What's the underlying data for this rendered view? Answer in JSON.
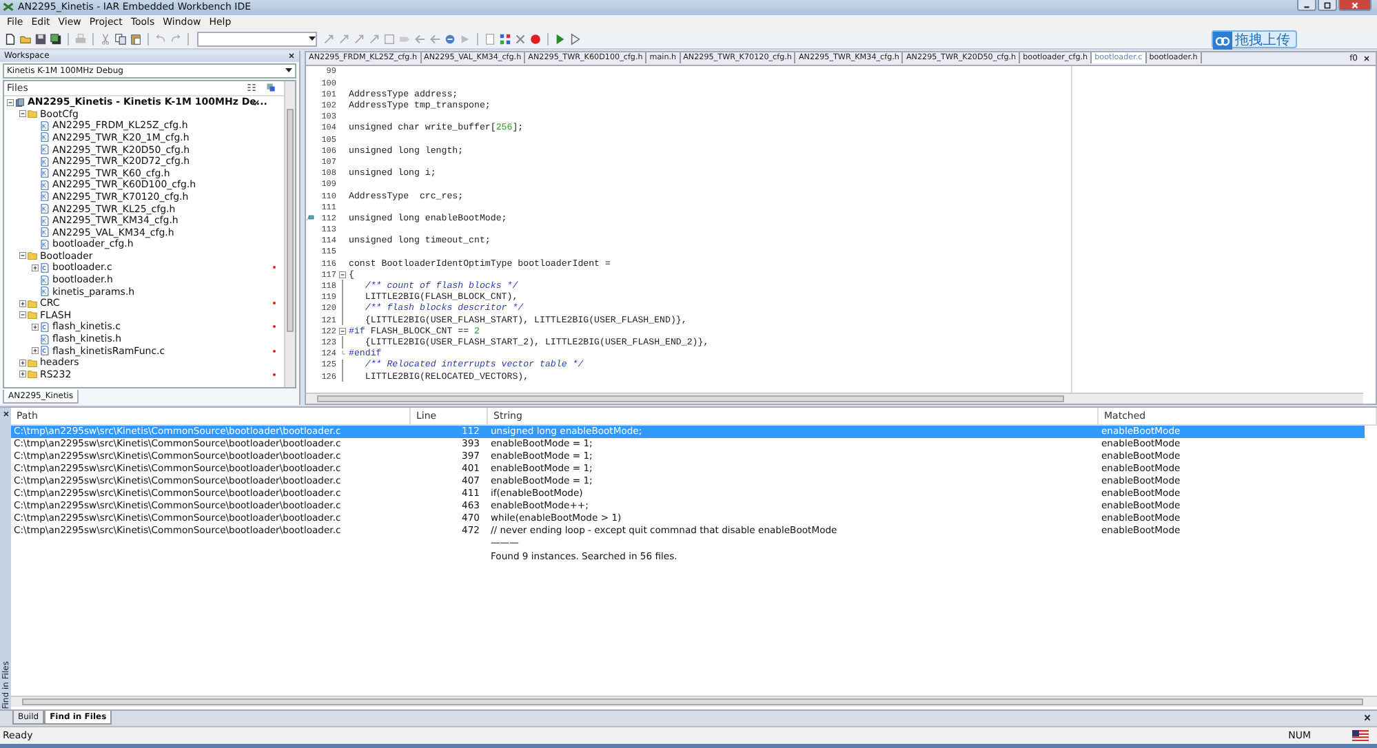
{
  "window": {
    "title": "AN2295_Kinetis - IAR Embedded Workbench IDE"
  },
  "menu": [
    "File",
    "Edit",
    "View",
    "Project",
    "Tools",
    "Window",
    "Help"
  ],
  "upload_button": "拖拽上传",
  "workspace": {
    "title": "Workspace",
    "configuration": "Kinetis K-1M 100MHz Debug",
    "files_header": "Files",
    "tree": [
      {
        "label": "AN2295_Kinetis - Kinetis K-1M 100MHz De...",
        "kind": "project",
        "expanded": true,
        "checked": true,
        "marked": false,
        "children": [
          {
            "label": "BootCfg",
            "kind": "folder",
            "expanded": true,
            "marked": false,
            "children": [
              {
                "label": "AN2295_FRDM_KL25Z_cfg.h",
                "kind": "header",
                "marked": false
              },
              {
                "label": "AN2295_TWR_K20_1M_cfg.h",
                "kind": "header",
                "marked": false
              },
              {
                "label": "AN2295_TWR_K20D50_cfg.h",
                "kind": "header",
                "marked": false
              },
              {
                "label": "AN2295_TWR_K20D72_cfg.h",
                "kind": "header",
                "marked": false
              },
              {
                "label": "AN2295_TWR_K60_cfg.h",
                "kind": "header",
                "marked": false
              },
              {
                "label": "AN2295_TWR_K60D100_cfg.h",
                "kind": "header",
                "marked": false
              },
              {
                "label": "AN2295_TWR_K70120_cfg.h",
                "kind": "header",
                "marked": false
              },
              {
                "label": "AN2295_TWR_KL25_cfg.h",
                "kind": "header",
                "marked": false
              },
              {
                "label": "AN2295_TWR_KM34_cfg.h",
                "kind": "header",
                "marked": false
              },
              {
                "label": "AN2295_VAL_KM34_cfg.h",
                "kind": "header",
                "marked": false
              },
              {
                "label": "bootloader_cfg.h",
                "kind": "header",
                "marked": false
              }
            ]
          },
          {
            "label": "Bootloader",
            "kind": "folder",
            "expanded": true,
            "marked": false,
            "children": [
              {
                "label": "bootloader.c",
                "kind": "source",
                "expanded": false,
                "marked": true
              },
              {
                "label": "bootloader.h",
                "kind": "header",
                "marked": false
              },
              {
                "label": "kinetis_params.h",
                "kind": "header",
                "marked": false
              }
            ]
          },
          {
            "label": "CRC",
            "kind": "folder",
            "expanded": false,
            "marked": true
          },
          {
            "label": "FLASH",
            "kind": "folder",
            "expanded": true,
            "marked": false,
            "children": [
              {
                "label": "flash_kinetis.c",
                "kind": "source",
                "expanded": false,
                "marked": true
              },
              {
                "label": "flash_kinetis.h",
                "kind": "header",
                "marked": false
              },
              {
                "label": "flash_kinetisRamFunc.c",
                "kind": "source",
                "expanded": false,
                "marked": true
              }
            ]
          },
          {
            "label": "headers",
            "kind": "folder",
            "expanded": false,
            "marked": false
          },
          {
            "label": "RS232",
            "kind": "folder",
            "expanded": false,
            "marked": true
          }
        ]
      }
    ],
    "bottom_tab": "AN2295_Kinetis"
  },
  "editor": {
    "tabs": [
      {
        "label": "AN2295_FRDM_KL25Z_cfg.h",
        "selected": false
      },
      {
        "label": "AN2295_VAL_KM34_cfg.h",
        "selected": false
      },
      {
        "label": "AN2295_TWR_K60D100_cfg.h",
        "selected": false
      },
      {
        "label": "main.h",
        "selected": false
      },
      {
        "label": "AN2295_TWR_K70120_cfg.h",
        "selected": false
      },
      {
        "label": "AN2295_TWR_KM34_cfg.h",
        "selected": false
      },
      {
        "label": "AN2295_TWR_K20D50_cfg.h",
        "selected": false
      },
      {
        "label": "bootloader_cfg.h",
        "selected": false
      },
      {
        "label": "bootloader.c",
        "selected": true
      },
      {
        "label": "bootloader.h",
        "selected": false
      }
    ],
    "tab_menu": "f0",
    "lines": [
      {
        "number": "99"
      },
      {
        "number": "100"
      },
      {
        "number": "101",
        "parts": [
          {
            "text": "AddressType address;",
            "kind": "plain"
          }
        ]
      },
      {
        "number": "102",
        "parts": [
          {
            "text": "AddressType tmp_transpone;",
            "kind": "plain"
          }
        ]
      },
      {
        "number": "103"
      },
      {
        "number": "104",
        "parts": [
          {
            "text": "unsigned char write_buffer[",
            "kind": "plain"
          },
          {
            "text": "256",
            "kind": "number"
          },
          {
            "text": "];",
            "kind": "plain"
          }
        ]
      },
      {
        "number": "105"
      },
      {
        "number": "106",
        "parts": [
          {
            "text": "unsigned long length;",
            "kind": "plain"
          }
        ]
      },
      {
        "number": "107"
      },
      {
        "number": "108",
        "parts": [
          {
            "text": "unsigned long i;",
            "kind": "plain"
          }
        ]
      },
      {
        "number": "109"
      },
      {
        "number": "110",
        "parts": [
          {
            "text": "AddressType  crc_res;",
            "kind": "plain"
          }
        ]
      },
      {
        "number": "111"
      },
      {
        "number": "112",
        "bookmark": true,
        "parts": [
          {
            "text": "unsigned long enableBootMode;",
            "kind": "plain"
          }
        ]
      },
      {
        "number": "113"
      },
      {
        "number": "114",
        "parts": [
          {
            "text": "unsigned long timeout_cnt;",
            "kind": "plain"
          }
        ]
      },
      {
        "number": "115"
      },
      {
        "number": "116",
        "parts": [
          {
            "text": "const BootloaderIdentOptimType bootloaderIdent =",
            "kind": "plain"
          }
        ]
      },
      {
        "number": "117",
        "fold_start": true,
        "parts": [
          {
            "text": "{",
            "kind": "plain"
          }
        ]
      },
      {
        "number": "118",
        "in_fold": true,
        "parts": [
          {
            "text": "   /** count of flash blocks */",
            "kind": "comment"
          }
        ]
      },
      {
        "number": "119",
        "in_fold": true,
        "parts": [
          {
            "text": "   LITTLE2BIG(FLASH_BLOCK_CNT),",
            "kind": "plain"
          }
        ]
      },
      {
        "number": "120",
        "in_fold": true,
        "parts": [
          {
            "text": "   /** flash blocks descritor */",
            "kind": "comment"
          }
        ]
      },
      {
        "number": "121",
        "in_fold": true,
        "parts": [
          {
            "text": "   {LITTLE2BIG(USER_FLASH_START), LITTLE2BIG(USER_FLASH_END)},",
            "kind": "plain"
          }
        ]
      },
      {
        "number": "122",
        "fold_start": true,
        "parts": [
          {
            "text": "#if",
            "kind": "preproc"
          },
          {
            "text": " FLASH_BLOCK_CNT == ",
            "kind": "plain"
          },
          {
            "text": "2",
            "kind": "number"
          }
        ]
      },
      {
        "number": "123",
        "in_fold": true,
        "parts": [
          {
            "text": "   {LITTLE2BIG(USER_FLASH_START_2), LITTLE2BIG(USER_FLASH_END_2)},",
            "kind": "plain"
          }
        ]
      },
      {
        "number": "124",
        "fold_end": true,
        "parts": [
          {
            "text": "#endif",
            "kind": "preproc"
          }
        ]
      },
      {
        "number": "125",
        "in_fold": true,
        "parts": [
          {
            "text": "   /** Relocated interrupts vector table */",
            "kind": "comment"
          }
        ]
      },
      {
        "number": "126",
        "in_fold": true,
        "parts": [
          {
            "text": "   LITTLE2BIG(RELOCATED_VECTORS),",
            "kind": "plain"
          }
        ]
      }
    ]
  },
  "results": {
    "side_label": "Find in Files",
    "columns": [
      "Path",
      "Line",
      "String",
      "Matched"
    ],
    "rows": [
      {
        "path": "C:\\tmp\\an2295sw\\src\\Kinetis\\CommonSource\\bootloader\\bootloader.c",
        "line": "112",
        "string": "unsigned long enableBootMode;",
        "matched": "enableBootMode",
        "selected": true
      },
      {
        "path": "C:\\tmp\\an2295sw\\src\\Kinetis\\CommonSource\\bootloader\\bootloader.c",
        "line": "393",
        "string": "enableBootMode = 1;",
        "matched": "enableBootMode",
        "selected": false
      },
      {
        "path": "C:\\tmp\\an2295sw\\src\\Kinetis\\CommonSource\\bootloader\\bootloader.c",
        "line": "397",
        "string": "enableBootMode = 1;",
        "matched": "enableBootMode",
        "selected": false
      },
      {
        "path": "C:\\tmp\\an2295sw\\src\\Kinetis\\CommonSource\\bootloader\\bootloader.c",
        "line": "401",
        "string": "enableBootMode = 1;",
        "matched": "enableBootMode",
        "selected": false
      },
      {
        "path": "C:\\tmp\\an2295sw\\src\\Kinetis\\CommonSource\\bootloader\\bootloader.c",
        "line": "407",
        "string": "enableBootMode = 1;",
        "matched": "enableBootMode",
        "selected": false
      },
      {
        "path": "C:\\tmp\\an2295sw\\src\\Kinetis\\CommonSource\\bootloader\\bootloader.c",
        "line": "411",
        "string": "if(enableBootMode)",
        "matched": "enableBootMode",
        "selected": false
      },
      {
        "path": "C:\\tmp\\an2295sw\\src\\Kinetis\\CommonSource\\bootloader\\bootloader.c",
        "line": "463",
        "string": "enableBootMode++;",
        "matched": "enableBootMode",
        "selected": false
      },
      {
        "path": "C:\\tmp\\an2295sw\\src\\Kinetis\\CommonSource\\bootloader\\bootloader.c",
        "line": "470",
        "string": "while(enableBootMode > 1)",
        "matched": "enableBootMode",
        "selected": false
      },
      {
        "path": "C:\\tmp\\an2295sw\\src\\Kinetis\\CommonSource\\bootloader\\bootloader.c",
        "line": "472",
        "string": "// never ending loop - except quit commnad that disable  enableBootMode",
        "matched": "enableBootMode",
        "selected": false
      }
    ],
    "separator": "———",
    "summary": "Found 9 instances. Searched in 56 files.",
    "tabs": [
      {
        "label": "Build",
        "selected": false
      },
      {
        "label": "Find in Files",
        "selected": true
      }
    ]
  },
  "status_bar": {
    "message": "Ready",
    "indicator": "NUM"
  }
}
